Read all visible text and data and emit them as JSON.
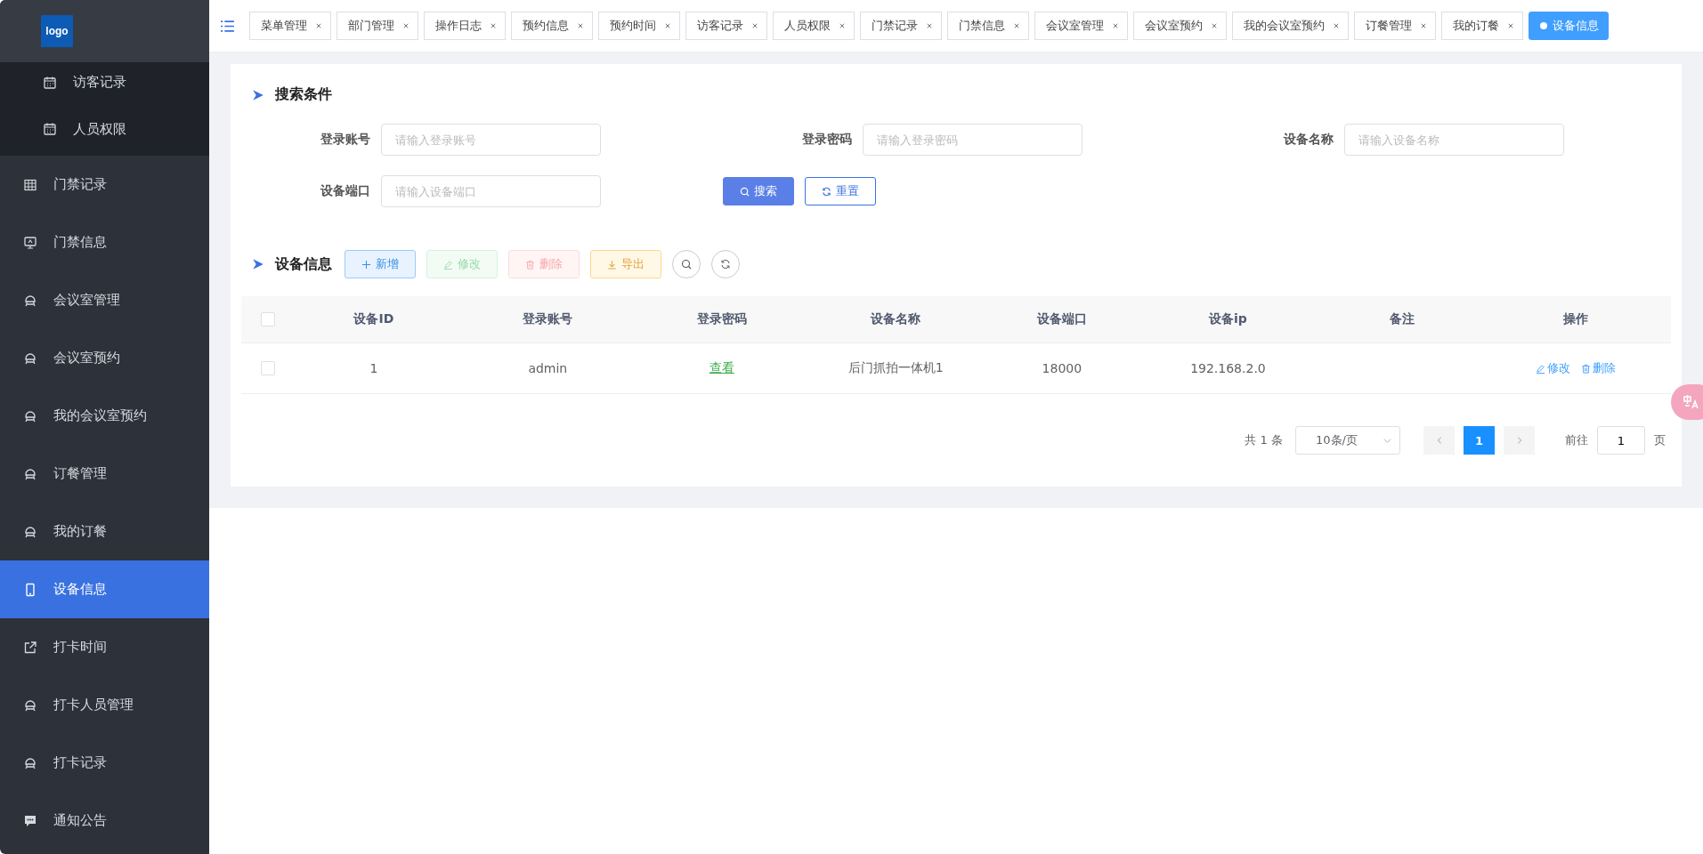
{
  "logo": "logo",
  "sidebar": {
    "items": [
      {
        "label": "访客记录",
        "kind": "subitem",
        "selected": false
      },
      {
        "label": "人员权限",
        "kind": "subitem",
        "selected": false
      },
      {
        "label": "门禁记录",
        "kind": "item",
        "selected": false
      },
      {
        "label": "门禁信息",
        "kind": "item",
        "selected": false
      },
      {
        "label": "会议室管理",
        "kind": "item",
        "selected": false
      },
      {
        "label": "会议室预约",
        "kind": "item",
        "selected": false
      },
      {
        "label": "我的会议室预约",
        "kind": "item",
        "selected": false
      },
      {
        "label": "订餐管理",
        "kind": "item",
        "selected": false
      },
      {
        "label": "我的订餐",
        "kind": "item",
        "selected": false
      },
      {
        "label": "设备信息",
        "kind": "item",
        "selected": true
      },
      {
        "label": "打卡时间",
        "kind": "item",
        "selected": false
      },
      {
        "label": "打卡人员管理",
        "kind": "item",
        "selected": false
      },
      {
        "label": "打卡记录",
        "kind": "item",
        "selected": false
      },
      {
        "label": "通知公告",
        "kind": "item",
        "selected": false
      }
    ]
  },
  "tabs": [
    {
      "label": "菜单管理",
      "selected": false
    },
    {
      "label": "部门管理",
      "selected": false
    },
    {
      "label": "操作日志",
      "selected": false
    },
    {
      "label": "预约信息",
      "selected": false
    },
    {
      "label": "预约时间",
      "selected": false
    },
    {
      "label": "访客记录",
      "selected": false
    },
    {
      "label": "人员权限",
      "selected": false
    },
    {
      "label": "门禁记录",
      "selected": false
    },
    {
      "label": "门禁信息",
      "selected": false
    },
    {
      "label": "会议室管理",
      "selected": false
    },
    {
      "label": "会议室预约",
      "selected": false
    },
    {
      "label": "我的会议室预约",
      "selected": false
    },
    {
      "label": "订餐管理",
      "selected": false
    },
    {
      "label": "我的订餐",
      "selected": false
    },
    {
      "label": "设备信息",
      "selected": true
    }
  ],
  "search": {
    "title": "搜索条件",
    "fields": [
      {
        "label": "登录账号",
        "placeholder": "请输入登录账号"
      },
      {
        "label": "登录密码",
        "placeholder": "请输入登录密码"
      },
      {
        "label": "设备名称",
        "placeholder": "请输入设备名称"
      },
      {
        "label": "设备端口",
        "placeholder": "请输入设备端口"
      }
    ],
    "search_button": "搜索",
    "reset_button": "重置"
  },
  "table": {
    "title": "设备信息",
    "toolbar": [
      {
        "label": "新增",
        "kind": "add",
        "disabled": false
      },
      {
        "label": "修改",
        "kind": "edit",
        "disabled": true
      },
      {
        "label": "删除",
        "kind": "delete",
        "disabled": true
      },
      {
        "label": "导出",
        "kind": "export",
        "disabled": false
      }
    ],
    "select_all": {
      "checked": false
    },
    "columns": [
      "设备ID",
      "登录账号",
      "登录密码",
      "设备名称",
      "设备端口",
      "设备ip",
      "备注",
      "操作"
    ],
    "rows": [
      {
        "checked": false,
        "id": "1",
        "account": "admin",
        "password_link": "查看",
        "name": "后门抓拍一体机1",
        "port": "18000",
        "ip": "192.168.2.0",
        "actions": [
          {
            "label": "修改",
            "kind": "edit"
          },
          {
            "label": "删除",
            "kind": "delete"
          }
        ]
      }
    ]
  },
  "pagination": {
    "total": "共 1 条",
    "page_size": "10条/页",
    "pages": [
      {
        "label": "1",
        "selected": true
      }
    ],
    "goto_label": "前往",
    "goto_value": "1",
    "goto_suffix": "页"
  }
}
